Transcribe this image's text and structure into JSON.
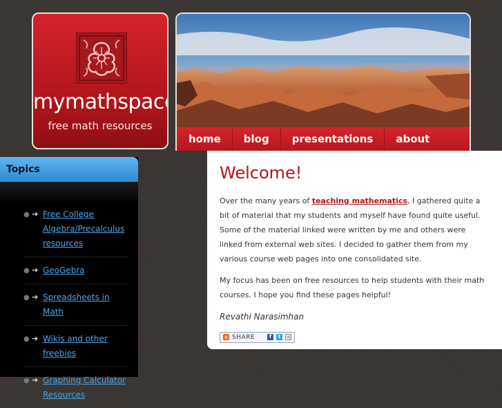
{
  "brand": {
    "title": "mymathspace",
    "tagline": "free math resources",
    "emblem_icon": "celtic-leaf-emblem-icon"
  },
  "nav": {
    "items": [
      {
        "label": "home"
      },
      {
        "label": "blog"
      },
      {
        "label": "presentations"
      },
      {
        "label": "about"
      }
    ]
  },
  "sidebar": {
    "heading": "Topics",
    "items": [
      {
        "label": "Free College Algebra/Precalculus resources"
      },
      {
        "label": "GeoGebra"
      },
      {
        "label": "Spreadsheets in Math"
      },
      {
        "label": "Wikis and other freebies"
      },
      {
        "label": "Graphing Calculator Resources"
      }
    ]
  },
  "main": {
    "heading": "Welcome!",
    "para1_before": "Over the many years of ",
    "para1_link": "teaching mathematics",
    "para1_after": ", I gathered quite a bit of material that my students and myself have found quite useful. Some of the material linked were written by me and others were linked from external web sites. I decided to gather them from my various course web pages into one consolidated site.",
    "para2": "My focus has been on free resources to help students with their math courses. I hope you find these pages helpful!",
    "signature": "Revathi Narasimhan",
    "share_label": "SHARE"
  },
  "colors": {
    "brand_red": "#c41e24",
    "link_blue": "#4aa6ec",
    "topics_blue": "#3b9ce0"
  }
}
